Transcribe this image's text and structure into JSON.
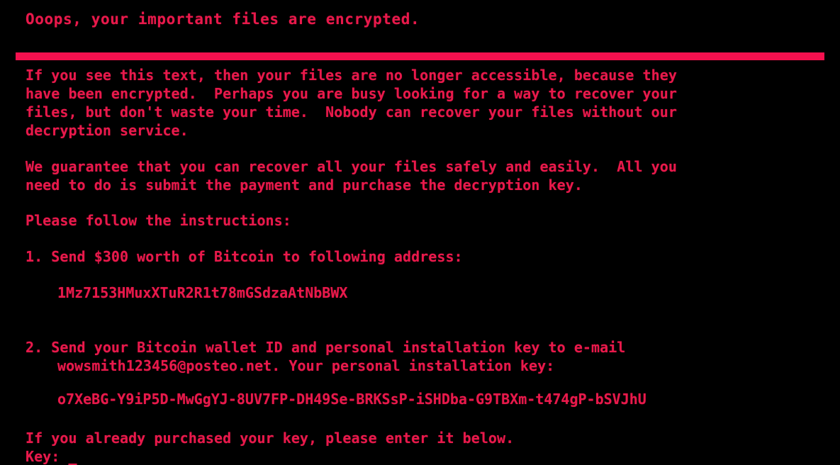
{
  "screen": {
    "background_color": "#000000",
    "text_color": "#e8194b",
    "bar_color": "#f4104e"
  },
  "title": "Ooops, your important files are encrypted.",
  "separator": {
    "name": "separator-bar"
  },
  "paragraph1": [
    "If you see this text, then your files are no longer accessible, because they",
    "have been encrypted.  Perhaps you are busy looking for a way to recover your",
    "files, but don't waste your time.  Nobody can recover your files without our",
    "decryption service."
  ],
  "paragraph2": [
    "We guarantee that you can recover all your files safely and easily.  All you",
    "need to do is submit the payment and purchase the decryption key."
  ],
  "instructions_header": "Please follow the instructions:",
  "step1": {
    "text": "1. Send $300 worth of Bitcoin to following address:",
    "bitcoin_address": "1Mz7153HMuxXTuR2R1t78mGSdzaAtNbBWX"
  },
  "step2": {
    "line1": "2. Send your Bitcoin wallet ID and personal installation key to e-mail",
    "line2": "wowsmith123456@posteo.net. Your personal installation key:",
    "email": "wowsmith123456@posteo.net",
    "installation_key": "o7XeBG-Y9iP5D-MwGgYJ-8UV7FP-DH49Se-BRKSsP-iSHDba-G9TBXm-t474gP-bSVJhU"
  },
  "footer": {
    "prompt_text": "If you already purchased your key, please enter it below.",
    "key_label": "Key: ",
    "key_value": "",
    "caret": "_"
  }
}
